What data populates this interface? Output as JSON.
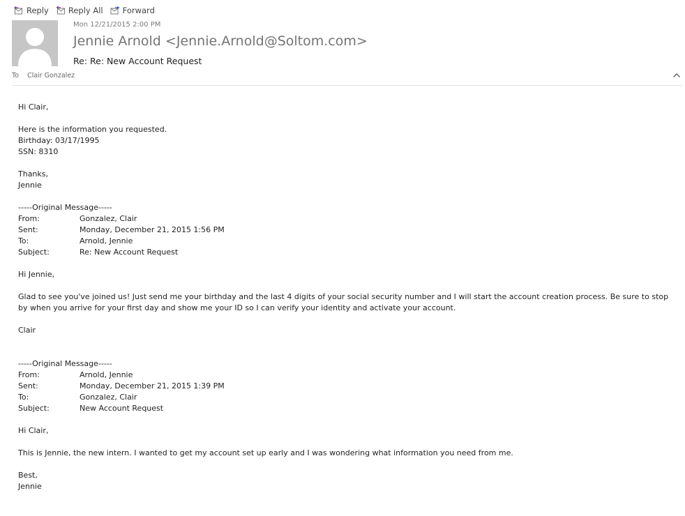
{
  "toolbar": {
    "reply_label": "Reply",
    "reply_all_label": "Reply All",
    "forward_label": "Forward"
  },
  "header": {
    "sent_time": "Mon 12/21/2015 2:00 PM",
    "sender": "Jennie Arnold <Jennie.Arnold@Soltom.com>",
    "subject": "Re: Re: New Account Request",
    "to_label": "To",
    "to_name": "Clair Gonzalez"
  },
  "body": {
    "greeting": "Hi Clair,",
    "line1": "Here is the information you requested.",
    "line2": "Birthday: 03/17/1995",
    "line3": "SSN: 8310",
    "closing": "Thanks,",
    "signature": "Jennie"
  },
  "quoted1": {
    "separator": "-----Original Message-----",
    "labels": {
      "from": "From:",
      "sent": "Sent:",
      "to": "To:",
      "subject": "Subject:"
    },
    "from": "Gonzalez, Clair",
    "sent": "Monday, December 21, 2015 1:56 PM",
    "to": "Arnold, Jennie",
    "subject": "Re: New Account Request",
    "greeting": "Hi Jennie,",
    "text": "Glad to see you've joined us! Just send me your birthday and the last 4 digits of your social security number and I will start the account creation process. Be sure to stop by when you arrive for your first day and show me your ID so I can verify your identity and activate your account.",
    "signature": "Clair"
  },
  "quoted2": {
    "separator": "-----Original Message-----",
    "labels": {
      "from": "From:",
      "sent": "Sent:",
      "to": "To:",
      "subject": "Subject:"
    },
    "from": "Arnold, Jennie",
    "sent": "Monday, December 21, 2015 1:39 PM",
    "to": "Gonzalez, Clair",
    "subject": "New Account Request",
    "greeting": "Hi Clair,",
    "text": "This is Jennie, the new intern. I wanted to get my account set up early and I was wondering what information you need from me.",
    "closing": "Best,",
    "signature": "Jennie"
  }
}
